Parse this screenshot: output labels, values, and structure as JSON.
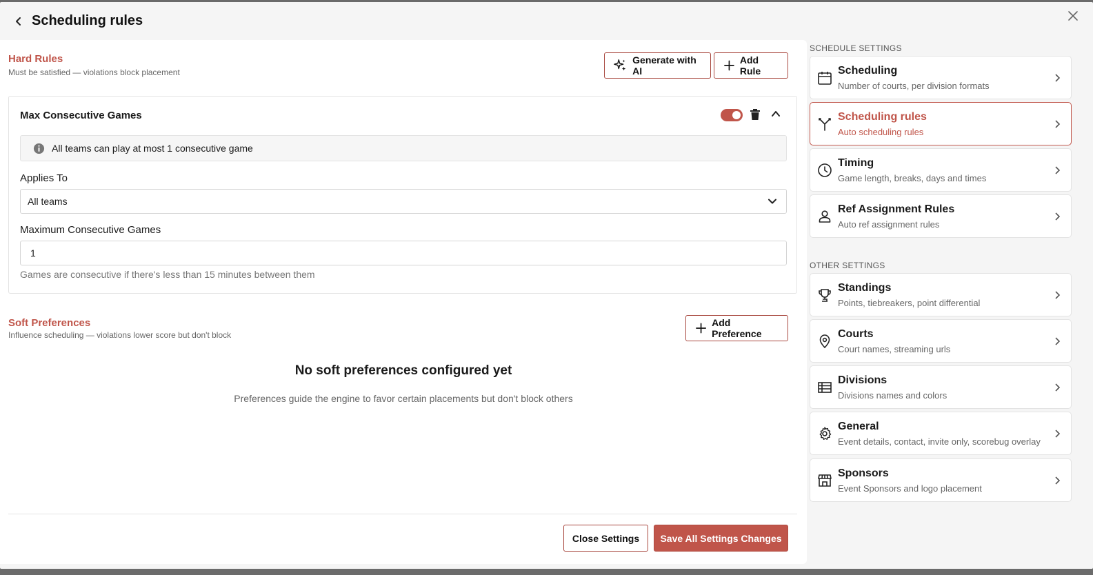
{
  "header": {
    "title": "Scheduling rules"
  },
  "hard_rules": {
    "title": "Hard Rules",
    "subtitle": "Must be satisfied — violations block placement",
    "generate_label": "Generate with AI",
    "add_rule_label": "Add Rule",
    "rule": {
      "name": "Max Consecutive Games",
      "enabled": true,
      "info": "All teams can play at most 1 consecutive game",
      "applies_to_label": "Applies To",
      "applies_to_value": "All teams",
      "max_label": "Maximum Consecutive Games",
      "max_value": "1",
      "hint": "Games are consecutive if there's less than 15 minutes between them"
    }
  },
  "soft_prefs": {
    "title": "Soft Preferences",
    "subtitle": "Influence scheduling — violations lower score but don't block",
    "add_label": "Add Preference",
    "empty_title": "No soft preferences configured yet",
    "empty_sub": "Preferences guide the engine to favor certain placements but don't block others"
  },
  "footer": {
    "close_label": "Close Settings",
    "save_label": "Save All Settings Changes"
  },
  "sidebar": {
    "schedule_group": "SCHEDULE SETTINGS",
    "other_group": "OTHER SETTINGS",
    "items": [
      {
        "title": "Scheduling",
        "sub": "Number of courts, per division formats",
        "icon": "calendar-icon"
      },
      {
        "title": "Scheduling rules",
        "sub": "Auto scheduling rules",
        "icon": "fork-icon",
        "active": true
      },
      {
        "title": "Timing",
        "sub": "Game length, breaks, days and times",
        "icon": "clock-icon"
      },
      {
        "title": "Ref Assignment Rules",
        "sub": "Auto ref assignment rules",
        "icon": "person-icon"
      },
      {
        "title": "Standings",
        "sub": "Points, tiebreakers, point differential",
        "icon": "trophy-icon"
      },
      {
        "title": "Courts",
        "sub": "Court names, streaming urls",
        "icon": "location-pin-icon"
      },
      {
        "title": "Divisions",
        "sub": "Divisions names and colors",
        "icon": "list-icon"
      },
      {
        "title": "General",
        "sub": "Event details, contact, invite only, scorebug overlay",
        "icon": "gear-icon"
      },
      {
        "title": "Sponsors",
        "sub": "Event Sponsors and logo placement",
        "icon": "storefront-icon"
      }
    ]
  },
  "colors": {
    "accent": "#c0554a",
    "background": "#f5f5f5"
  }
}
